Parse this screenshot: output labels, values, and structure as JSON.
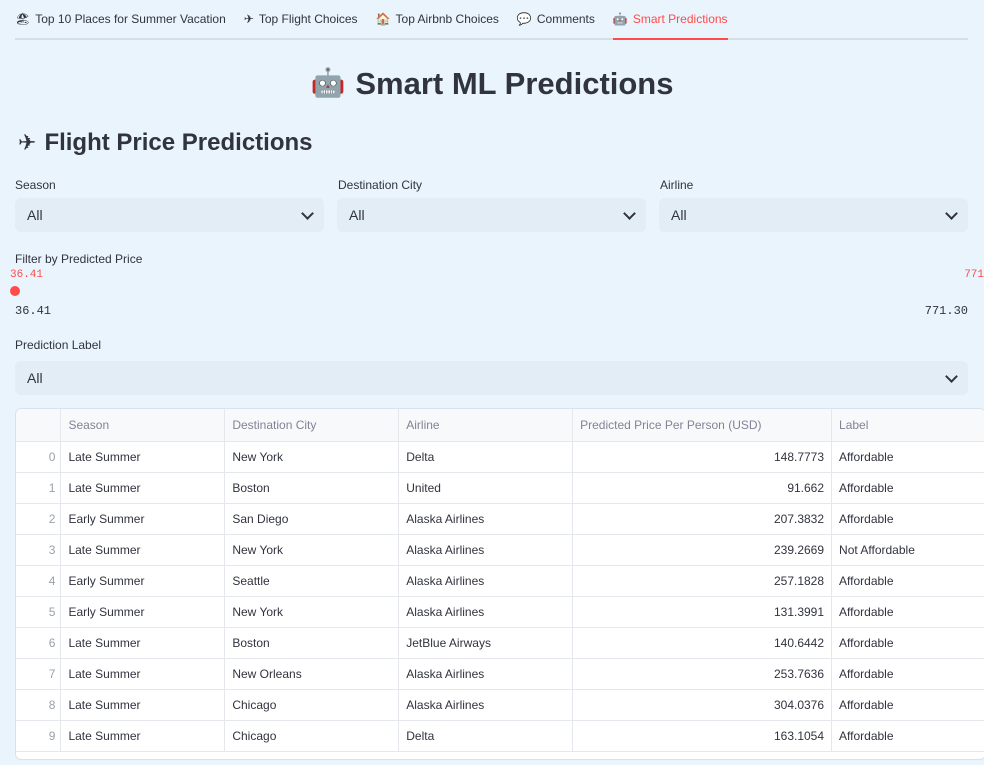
{
  "tabs": [
    {
      "icon": "🏖",
      "label": "Top 10 Places for Summer Vacation"
    },
    {
      "icon": "✈",
      "label": "Top Flight Choices"
    },
    {
      "icon": "🏠",
      "label": "Top Airbnb Choices"
    },
    {
      "icon": "💬",
      "label": "Comments"
    },
    {
      "icon": "🤖",
      "label": "Smart Predictions"
    }
  ],
  "title": "Smart ML Predictions",
  "title_icon": "🤖",
  "subtitle": "Flight Price Predictions",
  "subtitle_icon": "✈",
  "filters": {
    "season": {
      "label": "Season",
      "value": "All"
    },
    "city": {
      "label": "Destination City",
      "value": "All"
    },
    "airline": {
      "label": "Airline",
      "value": "All"
    },
    "price": {
      "label": "Filter by Predicted Price",
      "low_value": "36.41",
      "high_value": "771",
      "min": "36.41",
      "max": "771.30"
    },
    "prediction_label": {
      "label": "Prediction Label",
      "value": "All"
    }
  },
  "table": {
    "columns": [
      "",
      "Season",
      "Destination City",
      "Airline",
      "Predicted Price Per Person (USD)",
      "Label"
    ],
    "rows": [
      [
        "0",
        "Late Summer",
        "New York",
        "Delta",
        "148.7773",
        "Affordable"
      ],
      [
        "1",
        "Late Summer",
        "Boston",
        "United",
        "91.662",
        "Affordable"
      ],
      [
        "2",
        "Early Summer",
        "San Diego",
        "Alaska Airlines",
        "207.3832",
        "Affordable"
      ],
      [
        "3",
        "Late Summer",
        "New York",
        "Alaska Airlines",
        "239.2669",
        "Not Affordable"
      ],
      [
        "4",
        "Early Summer",
        "Seattle",
        "Alaska Airlines",
        "257.1828",
        "Affordable"
      ],
      [
        "5",
        "Early Summer",
        "New York",
        "Alaska Airlines",
        "131.3991",
        "Affordable"
      ],
      [
        "6",
        "Late Summer",
        "Boston",
        "JetBlue Airways",
        "140.6442",
        "Affordable"
      ],
      [
        "7",
        "Late Summer",
        "New Orleans",
        "Alaska Airlines",
        "253.7636",
        "Affordable"
      ],
      [
        "8",
        "Late Summer",
        "Chicago",
        "Alaska Airlines",
        "304.0376",
        "Affordable"
      ],
      [
        "9",
        "Late Summer",
        "Chicago",
        "Delta",
        "163.1054",
        "Affordable"
      ]
    ]
  }
}
